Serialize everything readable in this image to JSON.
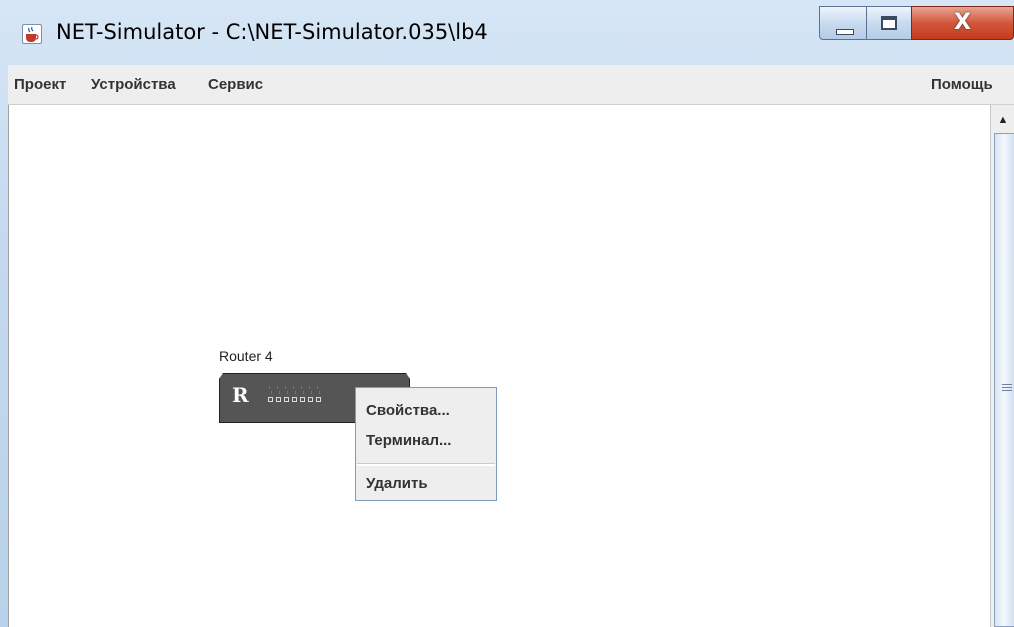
{
  "window": {
    "title": "NET-Simulator - C:\\NET-Simulator.035\\lb4",
    "icon": "java-cup-icon",
    "controls": {
      "minimize": "minimize-icon",
      "maximize": "maximize-icon",
      "close_label": "X"
    }
  },
  "menubar": {
    "items": [
      "Проект",
      "Устройства",
      "Сервис"
    ],
    "help": "Помощь"
  },
  "canvas": {
    "device": {
      "label": "Router 4",
      "letter": "R",
      "port_count": 7
    }
  },
  "context_menu": {
    "items": [
      "Свойства...",
      "Терминал...",
      "Удалить"
    ]
  },
  "scrollbar": {
    "up_arrow": "▲"
  },
  "colors": {
    "device_body": "#555555",
    "led": "#2ea82e",
    "menu_bg": "#eeeeee",
    "menu_border": "#7f9db9",
    "close_button": "#c43b1c"
  }
}
